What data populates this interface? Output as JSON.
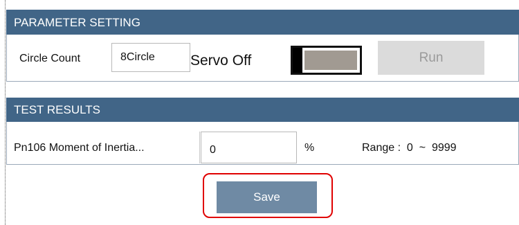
{
  "parameter_setting": {
    "title": "PARAMETER SETTING",
    "circle_count_label": "Circle Count",
    "circle_count_value": "8Circle",
    "servo_status": "Servo Off",
    "servo_on": false,
    "run_label": "Run"
  },
  "test_results": {
    "title": "TEST RESULTS",
    "parameter_label": "Pn106 Moment of Inertia...",
    "parameter_value": "0",
    "unit": "%",
    "range_label": "Range :  0  ~  9999"
  },
  "save_label": "Save",
  "colors": {
    "header_bg": "#416587",
    "save_button": "#6f8aa4",
    "run_button_disabled": "#dbdbdb",
    "highlight": "#e00000"
  }
}
